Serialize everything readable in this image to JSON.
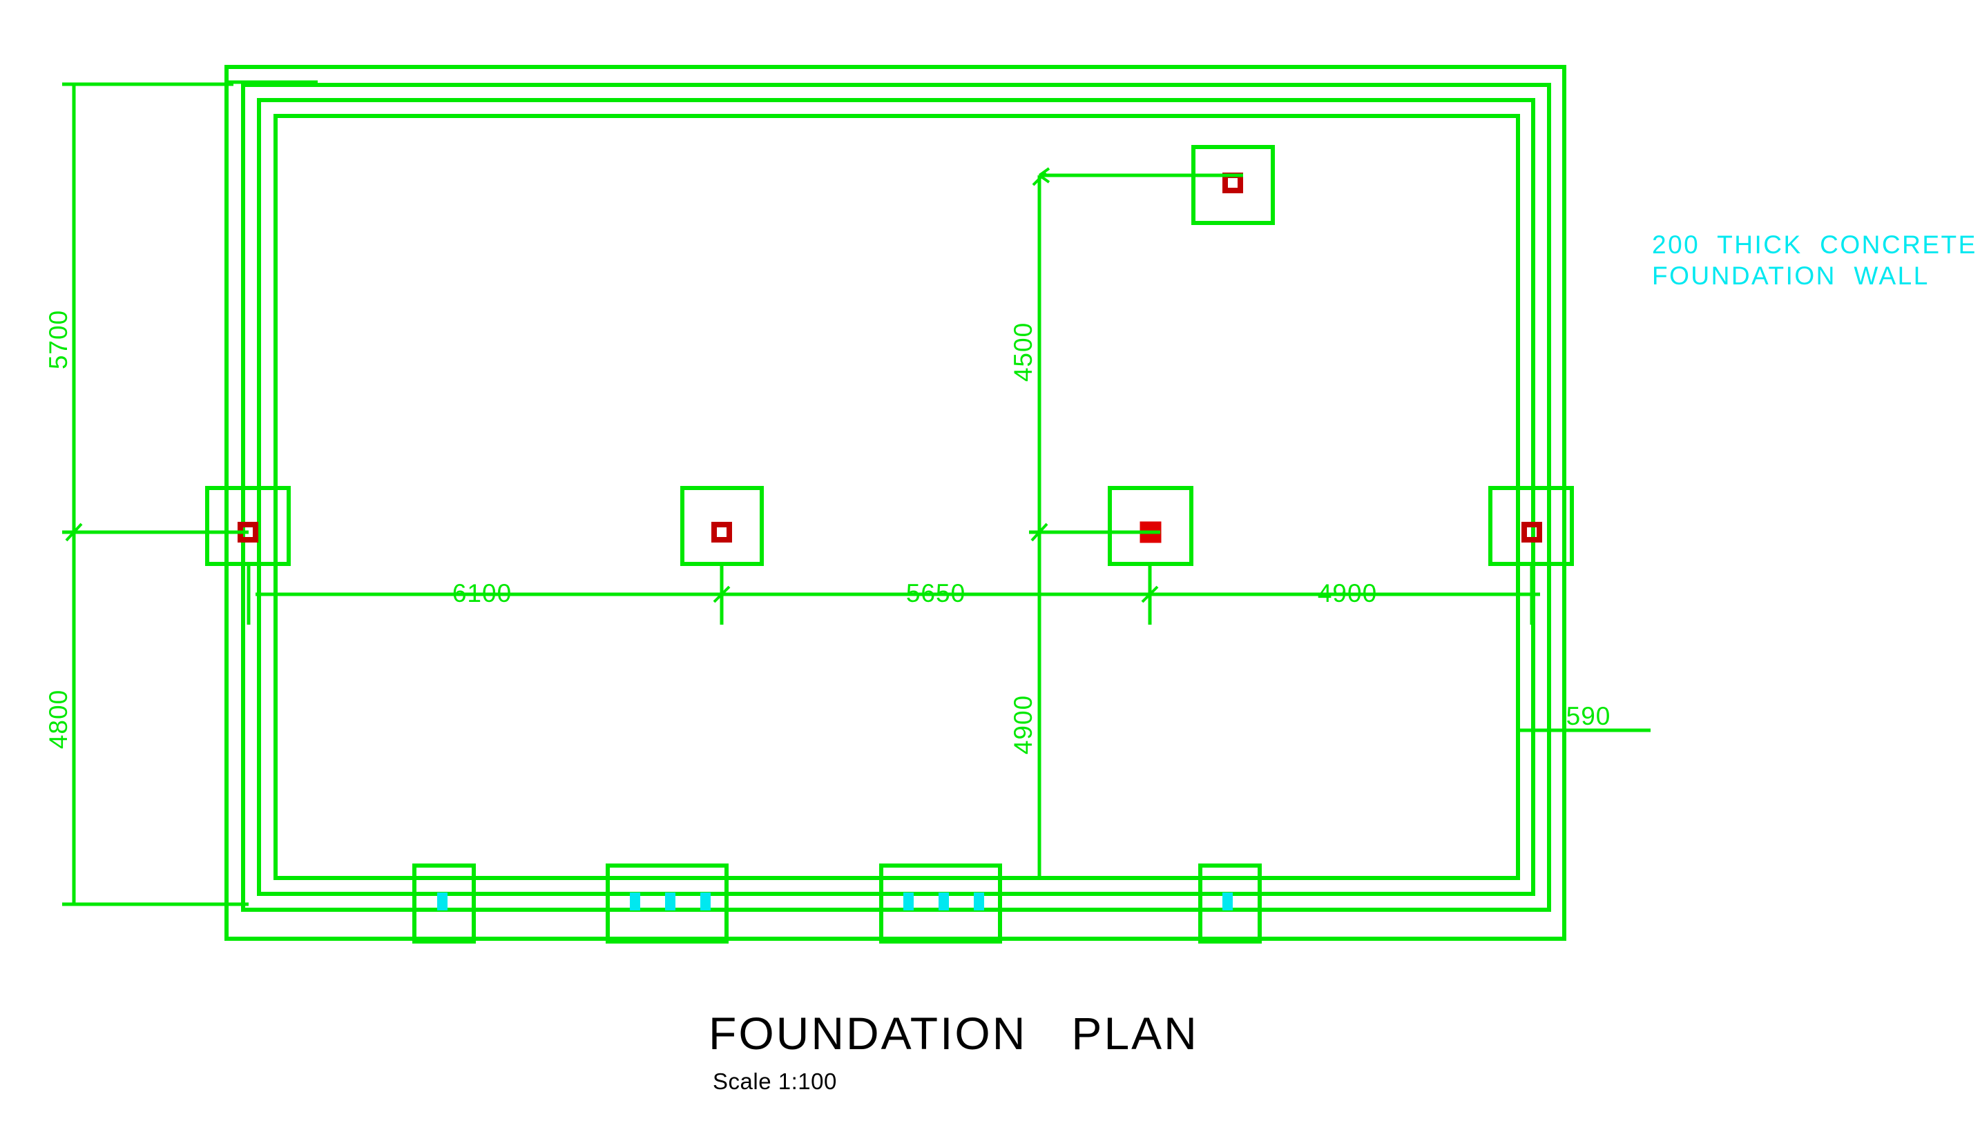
{
  "drawing": {
    "title": "FOUNDATION   PLAN",
    "scale_label": "Scale 1:100",
    "colors": {
      "lines": "#00e800",
      "column": "#e00000",
      "note": "#00e8f0",
      "title": "#000000",
      "background": "#ffffff"
    },
    "annotations": [
      {
        "id": "wall-note",
        "line1": "200  THICK  CONCRETE",
        "line2": "FOUNDATION  WALL",
        "color": "#00e8f0"
      }
    ],
    "dimensions": {
      "left_vertical": [
        {
          "id": "dim-5700",
          "value": "5700",
          "orientation": "vertical"
        },
        {
          "id": "dim-4800",
          "value": "4800",
          "orientation": "vertical"
        }
      ],
      "inner_vertical": [
        {
          "id": "dim-4500",
          "value": "4500",
          "orientation": "vertical"
        },
        {
          "id": "dim-4900",
          "value": "4900",
          "orientation": "vertical"
        }
      ],
      "horizontal_chain": [
        {
          "id": "dim-6100",
          "value": "6100",
          "orientation": "horizontal"
        },
        {
          "id": "dim-5650",
          "value": "5650",
          "orientation": "horizontal"
        },
        {
          "id": "dim-4900h",
          "value": "4900",
          "orientation": "horizontal"
        }
      ],
      "leader": [
        {
          "id": "dim-590",
          "value": "590",
          "orientation": "horizontal"
        }
      ]
    },
    "footings": [
      {
        "id": "footing-top-right",
        "marker": "open-square"
      },
      {
        "id": "footing-left",
        "marker": "open-square"
      },
      {
        "id": "footing-center",
        "marker": "open-square"
      },
      {
        "id": "footing-center-right",
        "marker": "filled-square"
      },
      {
        "id": "footing-right",
        "marker": "open-square"
      }
    ],
    "piers": [
      {
        "id": "pier-1",
        "width": "narrow",
        "bolts": 1
      },
      {
        "id": "pier-2",
        "width": "wide",
        "bolts": 3
      },
      {
        "id": "pier-3",
        "width": "wide",
        "bolts": 3
      },
      {
        "id": "pier-4",
        "width": "narrow",
        "bolts": 1
      }
    ]
  }
}
